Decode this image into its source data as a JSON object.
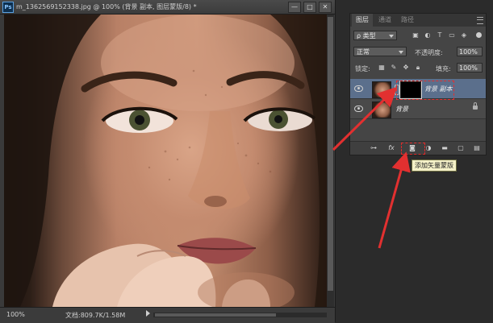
{
  "document": {
    "ps_logo": "Ps",
    "title": "m_1362569152338.jpg @ 100% (背景 副本, 图层蒙版/8) *",
    "window_buttons": [
      "—",
      "□",
      "✕"
    ],
    "status": {
      "zoom": "100%",
      "doc_size": "文档:809.7K/1.58M"
    }
  },
  "layers_panel": {
    "tabs": [
      {
        "label": "图层",
        "active": true
      },
      {
        "label": "通道",
        "active": false
      },
      {
        "label": "路径",
        "active": false
      }
    ],
    "filter_label": "ρ 类型",
    "blend_mode": "正常",
    "opacity_label": "不透明度:",
    "opacity_value": "100%",
    "lock_label": "锁定:",
    "fill_label": "填充:",
    "fill_value": "100%",
    "layers": [
      {
        "name": "背景 副本",
        "selected": true,
        "has_mask": true
      },
      {
        "name": "背景",
        "selected": false,
        "has_mask": false,
        "locked": true
      }
    ],
    "tooltip": "添加矢量蒙版"
  },
  "colors": {
    "selected_layer": "#5b6f8c",
    "annotation_red": "#e23030",
    "tooltip_bg": "#f5f1c8"
  },
  "icons": {
    "filter_icons": [
      "image-filter-icon",
      "adjustment-filter-icon",
      "type-filter-icon",
      "shape-filter-icon",
      "smart-object-filter-icon"
    ],
    "lock_icons": [
      "lock-transparent-icon",
      "lock-pixels-icon",
      "lock-position-icon",
      "lock-all-icon"
    ],
    "footer_icons": [
      "link-icon",
      "fx-icon",
      "add-mask-icon",
      "adjustment-layer-icon",
      "group-icon",
      "new-layer-icon",
      "trash-icon"
    ]
  }
}
